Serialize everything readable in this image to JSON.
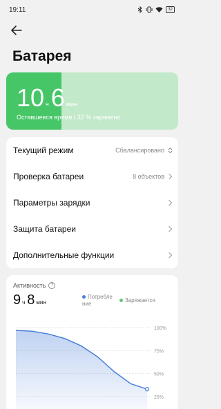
{
  "status_bar": {
    "time": "19:11",
    "icons": [
      "bluetooth-icon",
      "vibrate-icon",
      "wifi-icon",
      "battery-icon"
    ],
    "battery_level": "32"
  },
  "header": {
    "back_icon": "arrow-left-icon",
    "title": "Батарея"
  },
  "battery_card": {
    "hours": "10",
    "hours_unit": "ч",
    "minutes": "6",
    "minutes_unit": "мин",
    "subtitle": "Оставшееся время | 32 % заряжено",
    "charge_fraction": 0.32,
    "colors": {
      "fill": "#47c668",
      "track": "#c2e9ca"
    }
  },
  "settings": {
    "items": [
      {
        "label": "Текущий режим",
        "value": "Сбалансировано",
        "control": "updown-icon"
      },
      {
        "label": "Проверка батареи",
        "value": "8 объектов",
        "control": "chevron-right-icon"
      },
      {
        "label": "Параметры зарядки",
        "value": "",
        "control": "chevron-right-icon"
      },
      {
        "label": "Защита батареи",
        "value": "",
        "control": "chevron-right-icon"
      },
      {
        "label": "Дополнительные функции",
        "value": "",
        "control": "chevron-right-icon"
      }
    ]
  },
  "activity": {
    "title": "Активность",
    "hours": "9",
    "hours_unit": "ч",
    "minutes": "8",
    "minutes_unit": "мин",
    "legend": [
      {
        "label": "Потребле ние",
        "color": "#4a7fd8"
      },
      {
        "label": "Заряжается",
        "color": "#5cc874"
      }
    ]
  },
  "chart_data": {
    "type": "area",
    "ylabels": [
      "100%",
      "75%",
      "50%",
      "25%"
    ],
    "ylim": [
      25,
      100
    ],
    "series": [
      {
        "values": [
          97,
          96,
          93,
          88,
          80,
          68,
          52,
          39,
          33
        ]
      }
    ],
    "color": "#4a7fd8"
  }
}
